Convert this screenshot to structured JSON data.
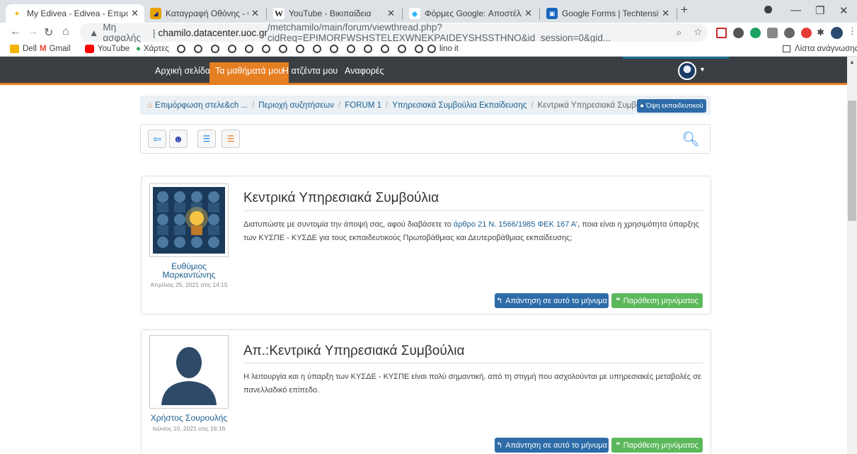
{
  "browser": {
    "tabs": [
      {
        "title": "My Edivea - Edivea - Επιμόρφωσ",
        "color": "#f4b400",
        "glyph": "✦",
        "active": true
      },
      {
        "title": "Καταγραφή Οθόνης - Οι Καλύτε",
        "color": "#e8a100",
        "glyph": "■"
      },
      {
        "title": "YouTube - Βικιπαίδεια",
        "color": "#ffffff",
        "glyph": "W"
      },
      {
        "title": "Φόρμες Google: Αποστέλλοντας",
        "color": "#29b6f6",
        "glyph": "◆"
      },
      {
        "title": "Google Forms | Techtensivist",
        "color": "#1565c0",
        "glyph": "▣"
      }
    ],
    "new_tab": "+",
    "window_controls": {
      "minimize": "—",
      "restore": "❐",
      "close": "✕"
    },
    "address": {
      "security": "Μη ασφαλής",
      "host": "chamilo.datacenter.uoc.gr",
      "path": "/metchamilo/main/forum/viewthread.php?cidReq=EPIMORFWSHSTELEXWNEKPAIDEYSHSSTHNO&id_session=0&gid..."
    },
    "bookmarks": [
      {
        "label": "Dell",
        "color": "#f4b400"
      },
      {
        "label": "Gmail",
        "color": "#ea4335"
      },
      {
        "label": "YouTube",
        "color": "#ff0000"
      },
      {
        "label": "Χάρτες",
        "color": "#34a853"
      }
    ],
    "bookmark_last": "lino it",
    "reading_list": "Λίστα ανάγνωσης"
  },
  "site": {
    "nav": [
      "Αρχική σελίδα",
      "Τα μαθήματά μου",
      "Η ατζέντα μου",
      "Αναφορές"
    ],
    "breadcrumb": [
      "Επιμόρφωση στελε&ch ...",
      "Περιοχή συζητήσεων",
      "FORUM 1",
      "Υπηρεσιακά Συμβούλια Εκπαίδευσης",
      "Κεντρικά Υπηρεσιακά Συμβούλια"
    ],
    "teacher_view": "Όψη εκπαιδευτικού"
  },
  "posts": [
    {
      "author_line1": "Ευθύμιος",
      "author_line2": "Μαρκαντώνης",
      "date": "Απρίλιος 25, 2021 στις 14:15",
      "title": "Κεντρικά Υπηρεσιακά Συμβούλια",
      "text_before": "Διατυπώστε με συντομία την άποψή σας, αφού διαβάσετε το ",
      "link": "άρθρο 21 Ν. 1566/1985 ΦΕΚ 167 Α'",
      "text_after": ", ποια είναι η χρησιμότητα ύπαρξης των ΚΥΣΠΕ - ΚΥΣΔΕ για τους εκπαιδευτικούς Πρωτοβάθμιας και Δευτεροβάθμιας εκπαίδευσης;",
      "reply": "Απάντηση σε αυτό το μήνυμα",
      "quote": "Παράθεση μηνύματος"
    },
    {
      "author_line1": "Χρήστος Σουρουλής",
      "date": "Ιούνιος 10, 2021 στις 16:16",
      "title": "Απ.:Κεντρικά Υπηρεσιακά Συμβούλια",
      "text": "Η λειτουργία και η ύπαρξη των ΚΥΣΔΕ - ΚΥΣΠΕ είναι πολύ σημαντική, από τη στιγμή που ασχολούνται με υπηρεσιακές μεταβολές σε πανελλαδικό επίπεδο.",
      "reply": "Απάντηση σε αυτό το μήνυμα",
      "quote": "Παράθεση μηνύματος"
    }
  ]
}
